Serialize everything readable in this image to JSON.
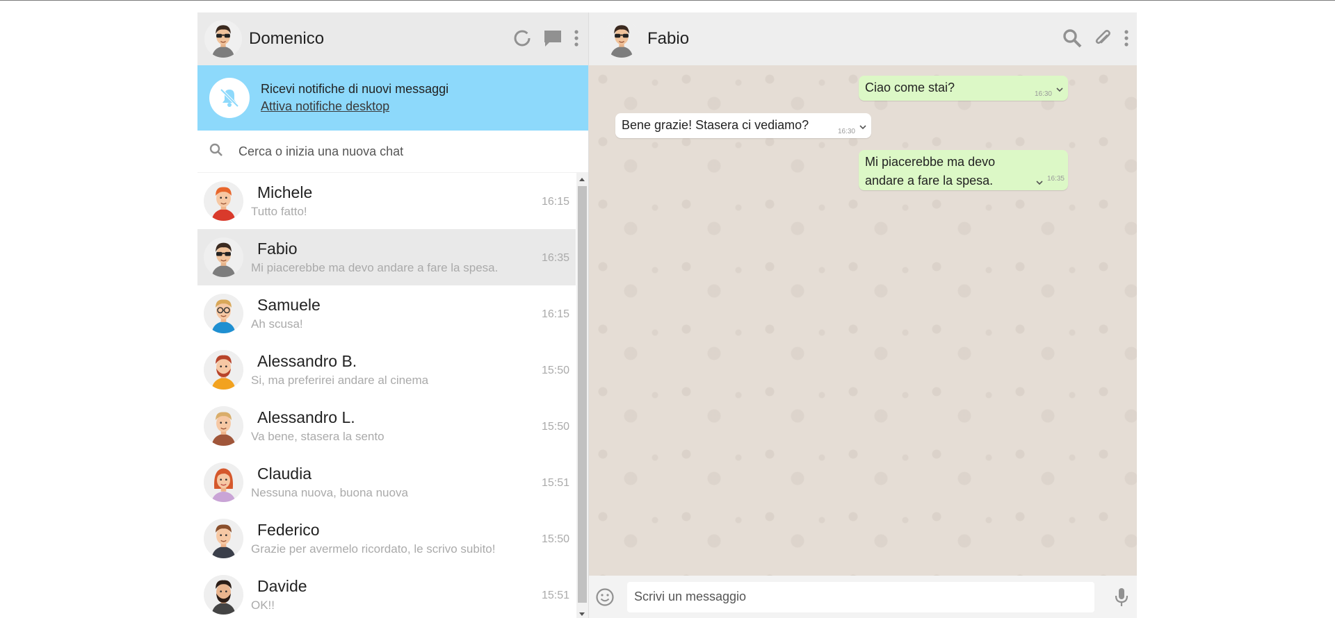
{
  "user": {
    "name": "Domenico",
    "avatar_icon": "avatar-sunglasses"
  },
  "notification": {
    "title": "Ricevi notifiche di nuovi messaggi",
    "link": "Attiva notifiche desktop",
    "icon": "bell-off-icon",
    "bg_color": "#8dd9fb"
  },
  "search": {
    "placeholder": "Cerca o inizia una nuova chat"
  },
  "contacts": [
    {
      "name": "Michele",
      "preview": "Tutto fatto!",
      "time": "16:15",
      "avatar_icon": "avatar-red-hair"
    },
    {
      "name": "Fabio",
      "preview": "Mi piacerebbe ma devo andare a fare la spesa.",
      "time": "16:35",
      "avatar_icon": "avatar-sunglasses"
    },
    {
      "name": "Samuele",
      "preview": "Ah scusa!",
      "time": "16:15",
      "avatar_icon": "avatar-glasses"
    },
    {
      "name": "Alessandro B.",
      "preview": "Si, ma preferirei andare al cinema",
      "time": "15:50",
      "avatar_icon": "avatar-beard-red"
    },
    {
      "name": "Alessandro L.",
      "preview": "Va bene, stasera la sento",
      "time": "15:50",
      "avatar_icon": "avatar-blond"
    },
    {
      "name": "Claudia",
      "preview": "Nessuna nuova, buona nuova",
      "time": "15:51",
      "avatar_icon": "avatar-woman"
    },
    {
      "name": "Federico",
      "preview": "Grazie per avermelo ricordato, le scrivo subito!",
      "time": "15:50",
      "avatar_icon": "avatar-brown-hair"
    },
    {
      "name": "Davide",
      "preview": "OK!!",
      "time": "15:51",
      "avatar_icon": "avatar-beard-dark"
    }
  ],
  "active_chat": {
    "name": "Fabio",
    "avatar_icon": "avatar-sunglasses",
    "messages": [
      {
        "direction": "sent",
        "text": "Ciao come stai?",
        "time": "16:30"
      },
      {
        "direction": "received",
        "text": "Bene grazie! Stasera ci vediamo?",
        "time": "16:30"
      },
      {
        "direction": "sent",
        "text": "Mi piacerebbe ma devo andare a fare la spesa.",
        "time": "16:35"
      }
    ]
  },
  "composer": {
    "placeholder": "Scrivi un messaggio"
  },
  "colors": {
    "sent_bubble": "#dcf8c6",
    "received_bubble": "#ffffff",
    "chat_background": "#e5ddd5",
    "active_row": "#e9e9e9",
    "header_bg": "#eaeaea"
  }
}
